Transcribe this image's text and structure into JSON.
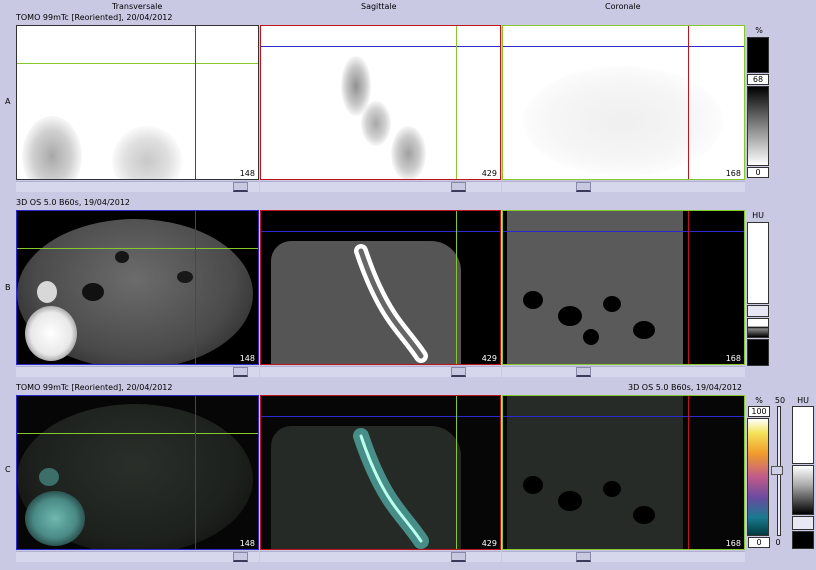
{
  "columns": {
    "transversale": "Transversale",
    "sagittale": "Sagittale",
    "coronale": "Coronale"
  },
  "rows": {
    "a": "A",
    "b": "B",
    "c": "C"
  },
  "headers": {
    "a": "TOMO 99mTc [Reoriented], 20/04/2012",
    "b": "3D  OS  5.0  B60s, 19/04/2012",
    "c_left": "TOMO 99mTc [Reoriented], 20/04/2012",
    "c_right": "3D  OS  5.0  B60s, 19/04/2012"
  },
  "slices": {
    "transversale": "148",
    "sagittale": "429",
    "coronale": "168"
  },
  "scale_pet": {
    "unit": "%",
    "max": "68",
    "min": "0"
  },
  "scale_ct": {
    "unit": "HU"
  },
  "scale_fusion": {
    "unit_pet": "%",
    "max": "100",
    "min": "0",
    "window": "50",
    "unit_ct": "HU",
    "ct_min": "0"
  },
  "colors": {
    "crosshair_red": "#c0141c",
    "crosshair_green": "#86c82c",
    "crosshair_blue": "#2a2ad0",
    "background": "#c9c9e4"
  }
}
